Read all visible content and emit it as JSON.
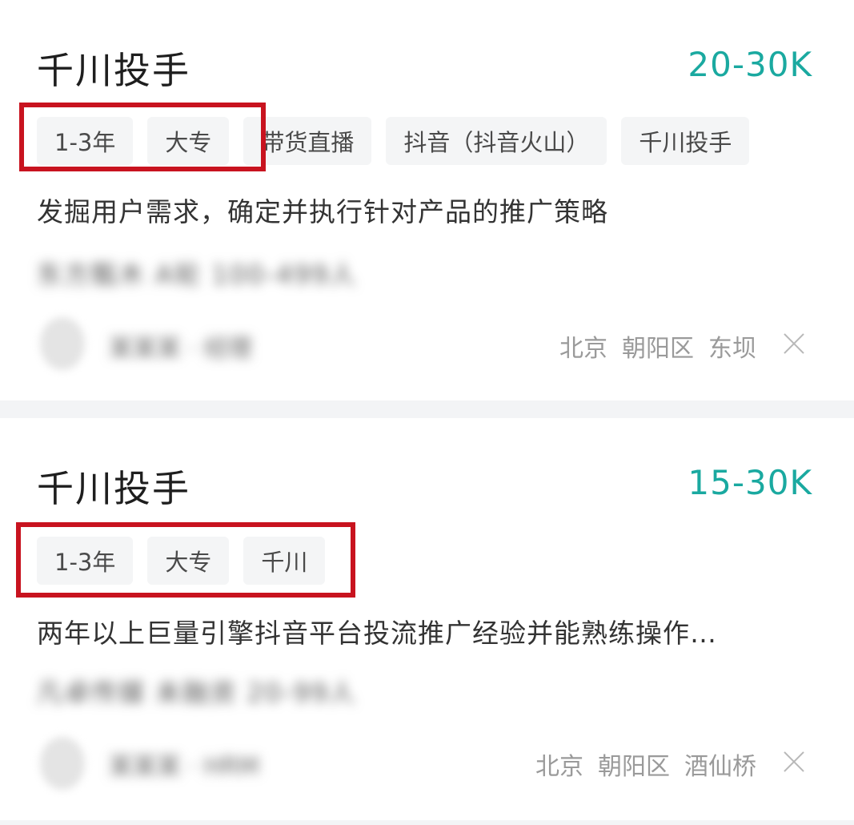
{
  "jobs": [
    {
      "title": "千川投手",
      "salary": "20-30K",
      "tags": [
        "1-3年",
        "大专",
        "带货直播",
        "抖音（抖音火山）",
        "千川投手"
      ],
      "description": "发掘用户需求，确定并执行针对产品的推广策略",
      "company": "东方甄木 A轮 100-499人",
      "recruiter": "某某某 · 经理",
      "location": [
        "北京",
        "朝阳区",
        "东坝"
      ]
    },
    {
      "title": "千川投手",
      "salary": "15-30K",
      "tags": [
        "1-3年",
        "大专",
        "千川"
      ],
      "description": "两年以上巨量引擎抖音平台投流推广经验并能熟练操作…",
      "company": "凡卓传媒 未融资 20-99人",
      "recruiter": "某某某 · HRM",
      "location": [
        "北京",
        "朝阳区",
        "酒仙桥"
      ]
    }
  ],
  "colors": {
    "salary": "#1aa9a0",
    "highlight": "#c8131f",
    "tag_bg": "#f4f5f6",
    "divider": "#f3f4f6"
  },
  "icons": {
    "dismiss": "close-icon"
  }
}
